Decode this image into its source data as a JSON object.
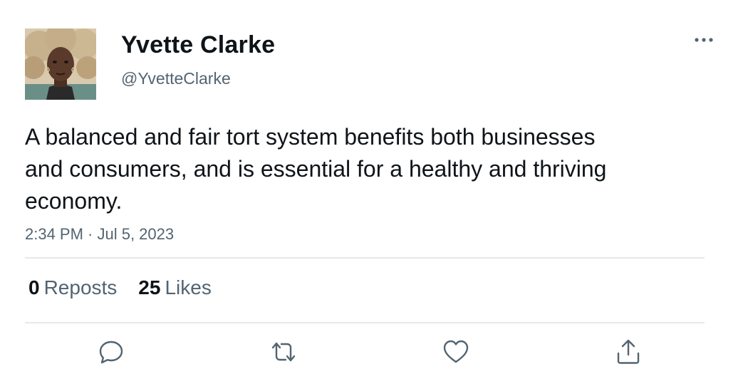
{
  "author": {
    "display_name": "Yvette Clarke",
    "handle": "@YvetteClarke"
  },
  "tweet": {
    "text": "A balanced and fair tort system benefits both businesses and consumers, and is essential for a healthy and thriving economy.",
    "timestamp": "2:34 PM · Jul 5, 2023"
  },
  "stats": {
    "reposts_count": "0",
    "reposts_label": "Reposts",
    "likes_count": "25",
    "likes_label": "Likes"
  },
  "actions": [
    {
      "icon": "reply-icon"
    },
    {
      "icon": "repost-icon"
    },
    {
      "icon": "heart-icon"
    },
    {
      "icon": "share-icon"
    }
  ],
  "more_icon": "more-horizontal-icon",
  "colors": {
    "primary_text": "#0f1419",
    "secondary_text": "#536471",
    "divider": "#e6e9eb"
  }
}
